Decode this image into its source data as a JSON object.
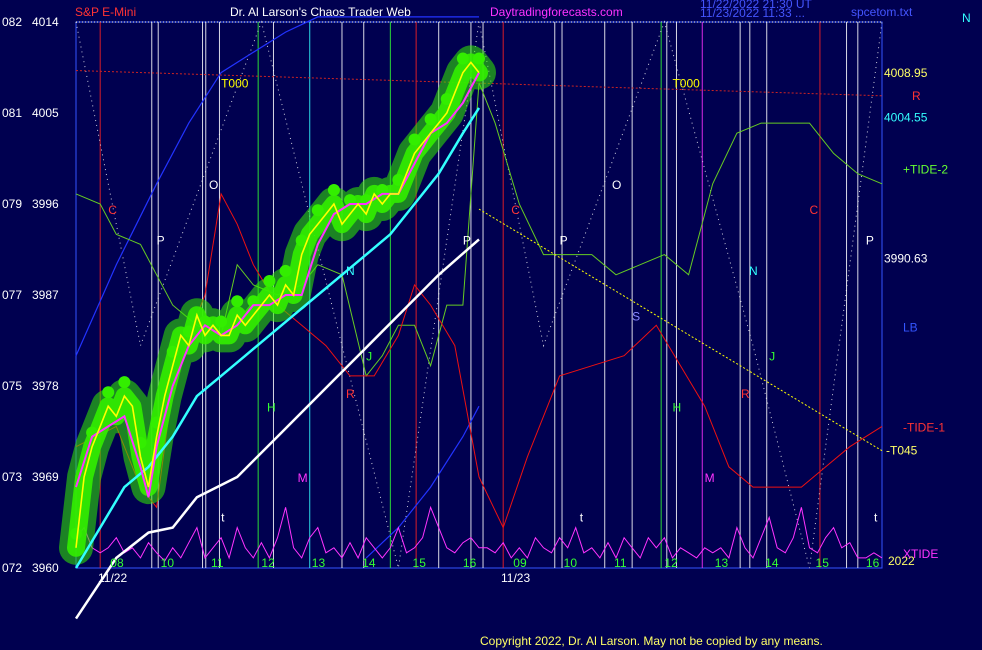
{
  "header": {
    "symbol": "S&P E-Mini",
    "title": "Dr. Al Larson's Chaos Trader Web",
    "site": "Daytradingforecasts.com",
    "stamp1": "11/22/2022 21:30 UT",
    "stamp2": "11/23/2022 11:33 ...",
    "file": "spcetom.txt",
    "corner": "N"
  },
  "copyright": "Copyright 2022, Dr. Al Larson. May not be copied by any means.",
  "colors": {
    "background": "#000050",
    "price": "#ffff00",
    "green_band": "#33ee00",
    "magenta_line": "#ff33ff",
    "cyan_ma": "#33ffff",
    "white_ma": "#ffffff",
    "blue_line": "#2233ff",
    "red_line": "#ee1111",
    "tide2_line": "#66cc22",
    "xtide_line": "#ff33ff",
    "vline_white": "#ffffff",
    "vline_green": "#33ff33",
    "vline_red": "#ff2222",
    "vline_magenta": "#ff33ff",
    "vline_cyan": "#33ffff"
  },
  "chart_data": {
    "type": "line",
    "title": "S&P E-Mini",
    "ylabels": [
      {
        "code": "082",
        "price": "4014"
      },
      {
        "code": "081",
        "price": "4005"
      },
      {
        "code": "079",
        "price": "3996"
      },
      {
        "code": "077",
        "price": "3987"
      },
      {
        "code": "075",
        "price": "3978"
      },
      {
        "code": "073",
        "price": "3969"
      },
      {
        "code": "072",
        "price": "3960"
      }
    ],
    "ylim": [
      3960,
      4014
    ],
    "x_hour_ticks": [
      "08",
      "10",
      "11",
      "12",
      "13",
      "14",
      "15",
      "16",
      "09",
      "10",
      "11",
      "12",
      "13",
      "14",
      "15",
      "16"
    ],
    "dates": [
      "11/22",
      "11/23"
    ],
    "year": "2022",
    "right_labels": [
      {
        "text": "4008.95",
        "value": 4008.95
      },
      {
        "text": "R",
        "value": 4006.7
      },
      {
        "text": "4004.55",
        "value": 4004.55
      },
      {
        "text": "+TIDE-2",
        "value": 3999.4
      },
      {
        "text": "3990.63",
        "value": 3990.63
      },
      {
        "text": "LB",
        "value": 3983.8
      },
      {
        "text": "-TIDE-1",
        "value": 3973.9
      },
      {
        "text": "-T045",
        "value": 3971.6
      },
      {
        "text": "XTIDE",
        "value": 3961.4
      }
    ],
    "inline_labels": [
      {
        "text": "T000",
        "x": 0.18,
        "y": 4007.5
      },
      {
        "text": "T000",
        "x": 0.74,
        "y": 4007.5
      },
      {
        "text": "C",
        "x": 0.04,
        "y": 3995
      },
      {
        "text": "C",
        "x": 0.54,
        "y": 3995
      },
      {
        "text": "C",
        "x": 0.91,
        "y": 3995
      },
      {
        "text": "P",
        "x": 0.1,
        "y": 3992
      },
      {
        "text": "P",
        "x": 0.48,
        "y": 3992
      },
      {
        "text": "P",
        "x": 0.6,
        "y": 3992
      },
      {
        "text": "P",
        "x": 0.98,
        "y": 3992
      },
      {
        "text": "O",
        "x": 0.165,
        "y": 3997.5
      },
      {
        "text": "O",
        "x": 0.665,
        "y": 3997.5
      },
      {
        "text": "N",
        "x": 0.335,
        "y": 3989
      },
      {
        "text": "N",
        "x": 0.835,
        "y": 3989
      },
      {
        "text": "S",
        "x": 0.69,
        "y": 3984.5
      },
      {
        "text": "J",
        "x": 0.36,
        "y": 3980.5
      },
      {
        "text": "J",
        "x": 0.86,
        "y": 3980.5
      },
      {
        "text": "R",
        "x": 0.335,
        "y": 3976.8
      },
      {
        "text": "R",
        "x": 0.825,
        "y": 3976.8
      },
      {
        "text": "H",
        "x": 0.237,
        "y": 3975.5
      },
      {
        "text": "H",
        "x": 0.74,
        "y": 3975.5
      },
      {
        "text": "M",
        "x": 0.275,
        "y": 3968.5
      },
      {
        "text": "M",
        "x": 0.78,
        "y": 3968.5
      },
      {
        "text": "t",
        "x": 0.18,
        "y": 3964.6
      },
      {
        "text": "t",
        "x": 0.625,
        "y": 3964.6
      },
      {
        "text": "t",
        "x": 0.99,
        "y": 3964.6
      }
    ],
    "vlines": [
      {
        "x": 0.03,
        "c": "red"
      },
      {
        "x": 0.094,
        "c": "white"
      },
      {
        "x": 0.102,
        "c": "white"
      },
      {
        "x": 0.157,
        "c": "white"
      },
      {
        "x": 0.161,
        "c": "white"
      },
      {
        "x": 0.178,
        "c": "white"
      },
      {
        "x": 0.226,
        "c": "green"
      },
      {
        "x": 0.245,
        "c": "white"
      },
      {
        "x": 0.29,
        "c": "cyan"
      },
      {
        "x": 0.33,
        "c": "white"
      },
      {
        "x": 0.357,
        "c": "white"
      },
      {
        "x": 0.39,
        "c": "green"
      },
      {
        "x": 0.422,
        "c": "red"
      },
      {
        "x": 0.45,
        "c": "white"
      },
      {
        "x": 0.49,
        "c": "white"
      },
      {
        "x": 0.505,
        "c": "white"
      },
      {
        "x": 0.53,
        "c": "red"
      },
      {
        "x": 0.594,
        "c": "white"
      },
      {
        "x": 0.603,
        "c": "white"
      },
      {
        "x": 0.656,
        "c": "white"
      },
      {
        "x": 0.69,
        "c": "white"
      },
      {
        "x": 0.726,
        "c": "green"
      },
      {
        "x": 0.733,
        "c": "white"
      },
      {
        "x": 0.745,
        "c": "white"
      },
      {
        "x": 0.777,
        "c": "magenta"
      },
      {
        "x": 0.824,
        "c": "white"
      },
      {
        "x": 0.836,
        "c": "white"
      },
      {
        "x": 0.857,
        "c": "white"
      },
      {
        "x": 0.923,
        "c": "red"
      },
      {
        "x": 0.956,
        "c": "white"
      },
      {
        "x": 0.97,
        "c": "white"
      }
    ],
    "series": [
      {
        "key": "price",
        "x": [
          0.0,
          0.01,
          0.02,
          0.03,
          0.04,
          0.05,
          0.06,
          0.07,
          0.08,
          0.09,
          0.1,
          0.11,
          0.12,
          0.13,
          0.14,
          0.15,
          0.16,
          0.17,
          0.18,
          0.19,
          0.2,
          0.21,
          0.22,
          0.23,
          0.24,
          0.25,
          0.26,
          0.27,
          0.28,
          0.29,
          0.3,
          0.31,
          0.32,
          0.33,
          0.34,
          0.35,
          0.36,
          0.37,
          0.38,
          0.39,
          0.4,
          0.41,
          0.42,
          0.43,
          0.44,
          0.45,
          0.46,
          0.47,
          0.48,
          0.49,
          0.5
        ],
        "y": [
          3962,
          3969,
          3972,
          3974,
          3976,
          3975,
          3977,
          3976,
          3971,
          3968,
          3973,
          3977,
          3980,
          3983,
          3982,
          3985,
          3983,
          3984,
          3983,
          3983,
          3985,
          3984,
          3985,
          3986,
          3987,
          3986,
          3988,
          3987,
          3991,
          3993,
          3994,
          3995,
          3996,
          3994,
          3995,
          3996,
          3995,
          3997,
          3996,
          3997,
          3997,
          3999,
          4001,
          4002,
          4003,
          4004,
          4005,
          4007,
          4009,
          4010,
          4009
        ]
      },
      {
        "key": "magenta_line",
        "x": [
          0.0,
          0.02,
          0.04,
          0.06,
          0.08,
          0.09,
          0.1,
          0.12,
          0.14,
          0.16,
          0.18,
          0.2,
          0.22,
          0.24,
          0.26,
          0.28,
          0.3,
          0.32,
          0.34,
          0.36,
          0.38,
          0.4,
          0.42,
          0.44,
          0.46,
          0.48,
          0.5
        ],
        "y": [
          3968,
          3973,
          3974,
          3975,
          3970,
          3967,
          3972,
          3978,
          3982,
          3984,
          3983,
          3984,
          3986,
          3986,
          3987,
          3987,
          3992,
          3995,
          3996,
          3996,
          3997,
          3997,
          4000,
          4003,
          4004,
          4006,
          4009
        ]
      },
      {
        "key": "cyan_ma",
        "x": [
          0.0,
          0.03,
          0.06,
          0.09,
          0.12,
          0.15,
          0.18,
          0.21,
          0.24,
          0.27,
          0.3,
          0.33,
          0.36,
          0.39,
          0.42,
          0.45,
          0.48,
          0.5
        ],
        "y": [
          3960,
          3964,
          3968,
          3970,
          3973,
          3977,
          3979,
          3981,
          3983,
          3985,
          3987,
          3989,
          3991,
          3993,
          3996,
          3999,
          4003,
          4005.5
        ]
      },
      {
        "key": "white_ma",
        "x": [
          0.0,
          0.05,
          0.09,
          0.12,
          0.15,
          0.2,
          0.25,
          0.3,
          0.35,
          0.4,
          0.45,
          0.5
        ],
        "y": [
          3955,
          3961,
          3963.5,
          3964,
          3967,
          3969,
          3973,
          3977,
          3981,
          3985,
          3989,
          3992.5
        ]
      },
      {
        "key": "red_line",
        "x": [
          0.0,
          0.05,
          0.08,
          0.1,
          0.12,
          0.14,
          0.16,
          0.18,
          0.2,
          0.22,
          0.25,
          0.28,
          0.31,
          0.34,
          0.37,
          0.4,
          0.42,
          0.44,
          0.47,
          0.5,
          0.53,
          0.56,
          0.6,
          0.64,
          0.68,
          0.72,
          0.75,
          0.78,
          0.81,
          0.84,
          0.87,
          0.9,
          0.93,
          0.96,
          1.0
        ],
        "y": [
          3972,
          3974,
          3968,
          3966,
          3978,
          3983,
          3987,
          3997,
          3994,
          3990,
          3986,
          3984,
          3982,
          3979,
          3979,
          3983,
          3988,
          3986,
          3982,
          3969,
          3964,
          3971,
          3979,
          3980,
          3981,
          3984,
          3980,
          3976,
          3970,
          3968,
          3968,
          3968,
          3970,
          3972,
          3974
        ]
      },
      {
        "key": "tide2_line",
        "x": [
          0.0,
          0.03,
          0.05,
          0.08,
          0.1,
          0.12,
          0.15,
          0.18,
          0.2,
          0.22,
          0.25,
          0.28,
          0.3,
          0.33,
          0.36,
          0.38,
          0.4,
          0.42,
          0.44,
          0.46,
          0.48,
          0.5,
          0.52,
          0.55,
          0.58,
          0.61,
          0.64,
          0.67,
          0.7,
          0.73,
          0.76,
          0.79,
          0.82,
          0.85,
          0.88,
          0.91,
          0.94,
          0.97,
          1.0
        ],
        "y": [
          3997,
          3996,
          3993,
          3992,
          3989,
          3986,
          3984,
          3983,
          3990,
          3988,
          3987,
          3988,
          3990,
          3989,
          3979,
          3981,
          3984,
          3984,
          3980,
          3986,
          3986,
          4008,
          4004,
          3996,
          3991,
          3991,
          3991,
          3989,
          3990,
          3991,
          3989,
          3998,
          4003,
          4004,
          4004,
          4004,
          4001,
          3999,
          3998
        ]
      },
      {
        "key": "blue_line",
        "x": [
          0.0,
          0.05,
          0.1,
          0.14,
          0.18,
          0.22,
          0.26,
          0.3,
          0.34,
          0.38,
          0.42,
          0.46,
          0.5
        ],
        "y": [
          3981,
          3990,
          3998,
          4004,
          4009,
          4011,
          4013,
          4014.5,
          4014.5,
          4014.5,
          4014.5,
          4014.5,
          4014.5
        ]
      },
      {
        "key": "blue_line_lower",
        "x": [
          0.36,
          0.4,
          0.44,
          0.48,
          0.5
        ],
        "y": [
          3961,
          3964,
          3968,
          3973,
          3976
        ]
      },
      {
        "key": "xtide_line",
        "x": [
          0.0,
          0.01,
          0.02,
          0.03,
          0.04,
          0.05,
          0.06,
          0.07,
          0.08,
          0.09,
          0.1,
          0.11,
          0.12,
          0.13,
          0.14,
          0.15,
          0.16,
          0.17,
          0.18,
          0.19,
          0.2,
          0.21,
          0.22,
          0.23,
          0.24,
          0.25,
          0.26,
          0.27,
          0.28,
          0.29,
          0.3,
          0.31,
          0.32,
          0.33,
          0.34,
          0.35,
          0.36,
          0.37,
          0.38,
          0.39,
          0.4,
          0.41,
          0.42,
          0.43,
          0.44,
          0.45,
          0.46,
          0.47,
          0.48,
          0.49,
          0.5,
          0.51,
          0.52,
          0.53,
          0.54,
          0.55,
          0.56,
          0.57,
          0.58,
          0.59,
          0.6,
          0.61,
          0.62,
          0.63,
          0.64,
          0.65,
          0.66,
          0.67,
          0.68,
          0.69,
          0.7,
          0.71,
          0.72,
          0.73,
          0.74,
          0.75,
          0.76,
          0.77,
          0.78,
          0.79,
          0.8,
          0.81,
          0.82,
          0.83,
          0.84,
          0.85,
          0.86,
          0.87,
          0.88,
          0.89,
          0.9,
          0.91,
          0.92,
          0.93,
          0.94,
          0.95,
          0.96,
          0.97,
          0.98,
          0.99,
          1.0
        ],
        "y": [
          3963,
          3964,
          3962,
          3961.5,
          3962,
          3963,
          3961.5,
          3962,
          3961,
          3962.5,
          3961.5,
          3960.7,
          3962,
          3961,
          3962.5,
          3964,
          3961,
          3962,
          3963,
          3961,
          3964,
          3962,
          3961,
          3962.5,
          3961,
          3963,
          3966,
          3962,
          3961,
          3963,
          3964,
          3961.5,
          3962,
          3961,
          3962.5,
          3961,
          3963,
          3962,
          3961,
          3962,
          3964,
          3961.5,
          3962,
          3963,
          3966,
          3964,
          3962,
          3961.5,
          3962.5,
          3963,
          3962,
          3962,
          3961.5,
          3962.5,
          3961,
          3962,
          3961,
          3963,
          3962,
          3961.5,
          3963,
          3962,
          3964,
          3961.5,
          3962,
          3961,
          3962.5,
          3961,
          3963,
          3962,
          3961,
          3963,
          3962,
          3963,
          3961,
          3962,
          3961.5,
          3961,
          3962,
          3961.5,
          3962,
          3961,
          3964,
          3962,
          3961,
          3963,
          3965,
          3962,
          3961.5,
          3963,
          3966,
          3962,
          3961.5,
          3963,
          3964,
          3962,
          3962.5,
          3961,
          3961,
          3961.5,
          3961
        ]
      },
      {
        "key": "forecast_yellow",
        "x": [
          0.5,
          1.0
        ],
        "y": [
          3995.5,
          3971.6
        ]
      }
    ],
    "dotted_lines": [
      {
        "x": [
          0.0,
          0.0
        ],
        "y": [
          3990,
          3990
        ]
      },
      {
        "x": [
          0.0,
          1.0
        ],
        "y": [
          4009.2,
          4006.7
        ]
      }
    ],
    "zigzag_x": [
      0.0,
      0.08,
      0.23,
      0.33,
      0.4,
      0.5,
      0.58,
      0.73,
      0.84,
      0.91,
      1.0
    ],
    "zigzag_y": [
      4014,
      3982,
      4014,
      3982,
      3960,
      4014,
      3982,
      4014,
      3982,
      3960,
      4014
    ],
    "grid": false,
    "legend": "none"
  }
}
